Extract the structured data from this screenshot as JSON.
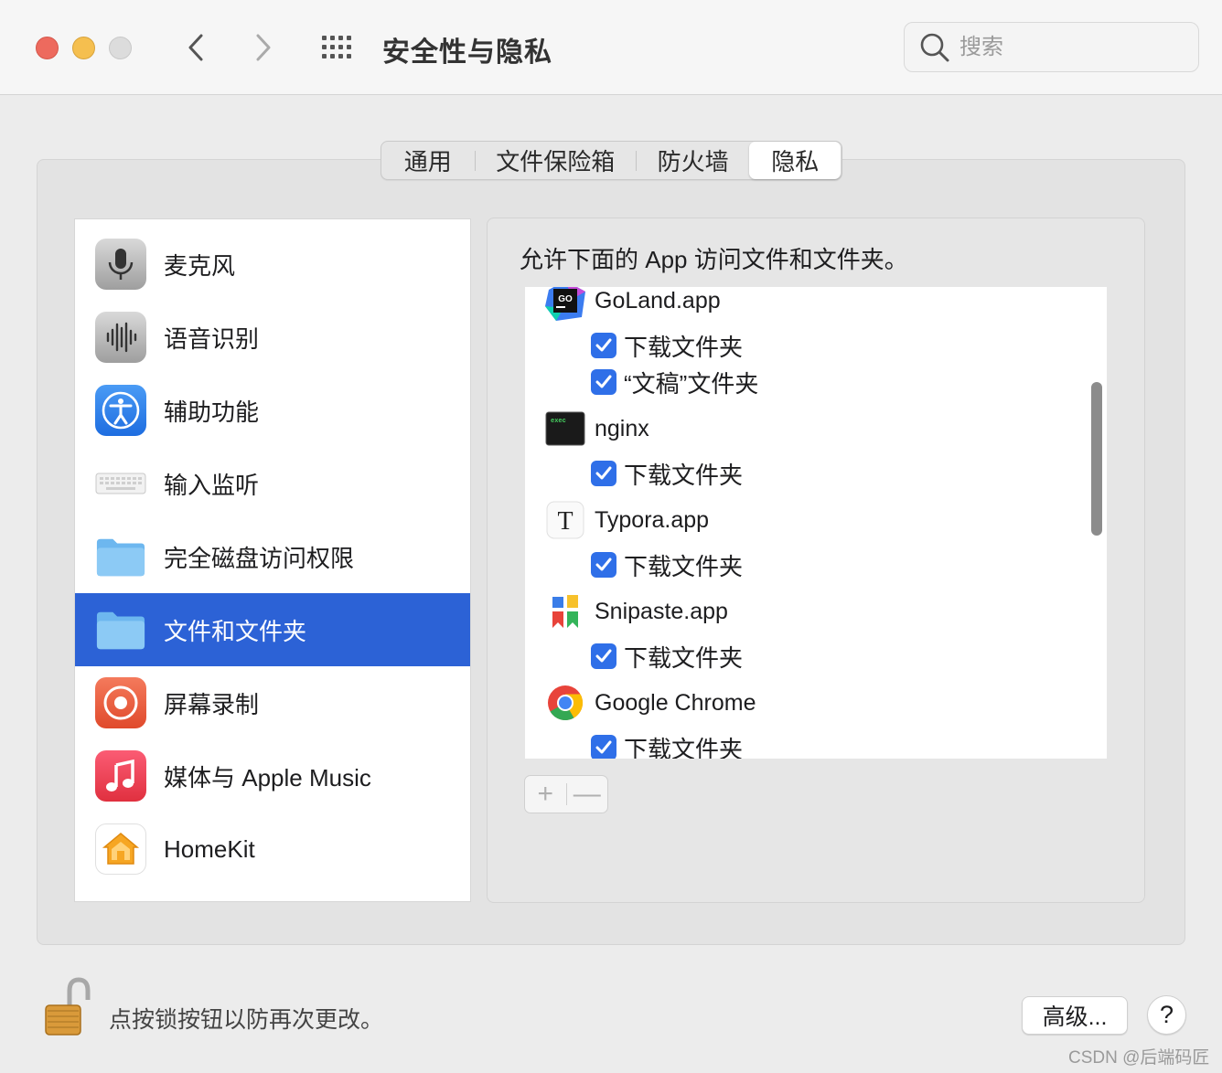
{
  "window": {
    "title": "安全性与隐私",
    "search_placeholder": "搜索"
  },
  "tabs": [
    {
      "label": "通用",
      "selected": false
    },
    {
      "label": "文件保险箱",
      "selected": false
    },
    {
      "label": "防火墙",
      "selected": false
    },
    {
      "label": "隐私",
      "selected": true
    }
  ],
  "sidebar": {
    "items": [
      {
        "label": "麦克风",
        "icon": "microphone-icon",
        "selected": false
      },
      {
        "label": "语音识别",
        "icon": "speech-recognition-icon",
        "selected": false
      },
      {
        "label": "辅助功能",
        "icon": "accessibility-icon",
        "selected": false
      },
      {
        "label": "输入监听",
        "icon": "keyboard-icon",
        "selected": false
      },
      {
        "label": "完全磁盘访问权限",
        "icon": "folder-icon",
        "selected": false
      },
      {
        "label": "文件和文件夹",
        "icon": "folder-icon",
        "selected": true
      },
      {
        "label": "屏幕录制",
        "icon": "screen-recording-icon",
        "selected": false
      },
      {
        "label": "媒体与 Apple Music",
        "icon": "music-icon",
        "selected": false
      },
      {
        "label": "HomeKit",
        "icon": "home-icon",
        "selected": false
      }
    ]
  },
  "panel": {
    "description": "允许下面的 App 访问文件和文件夹。",
    "apps": [
      {
        "name": "GoLand.app",
        "icon": "goland-icon",
        "permissions": [
          {
            "label": "下载文件夹",
            "checked": true
          },
          {
            "label": "“文稿”文件夹",
            "checked": true
          }
        ]
      },
      {
        "name": "nginx",
        "icon": "terminal-exec-icon",
        "icon_text": "exec",
        "permissions": [
          {
            "label": "下载文件夹",
            "checked": true
          }
        ]
      },
      {
        "name": "Typora.app",
        "icon": "typora-icon",
        "icon_text": "T",
        "permissions": [
          {
            "label": "下载文件夹",
            "checked": true
          }
        ]
      },
      {
        "name": "Snipaste.app",
        "icon": "snipaste-icon",
        "permissions": [
          {
            "label": "下载文件夹",
            "checked": true
          }
        ]
      },
      {
        "name": "Google Chrome",
        "icon": "chrome-icon",
        "permissions": [
          {
            "label": "下载文件夹",
            "checked": true
          }
        ]
      }
    ],
    "add_label": "+",
    "remove_label": "—"
  },
  "footer": {
    "lock_text": "点按锁按钮以防再次更改。",
    "advanced_label": "高级...",
    "help_label": "?",
    "watermark": "CSDN @后端码匠"
  },
  "colors": {
    "accent": "#2c62d6",
    "checkbox": "#2f6fe8",
    "close": "#ed6a5e",
    "minimize": "#f5bf4f"
  }
}
